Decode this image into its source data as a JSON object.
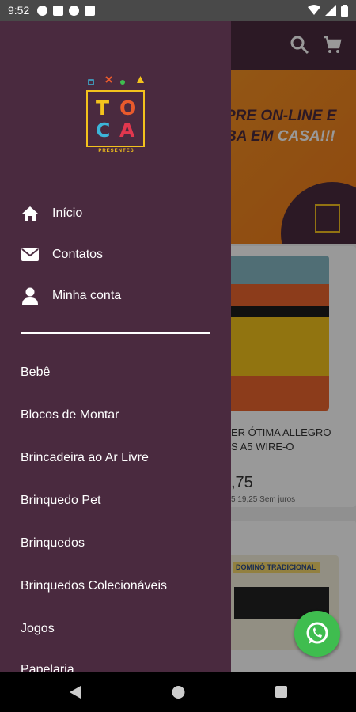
{
  "status_bar": {
    "time": "9:52"
  },
  "app": {
    "banner": {
      "line1": "PRE ON-LINE E",
      "line2_a": "BA EM ",
      "line2_b": "CASA!!!"
    },
    "product1": {
      "title_line1": "ER ÓTIMA ALLEGRO",
      "title_line2": "S A5 WIRE-O",
      "price": ",75",
      "installments": "5 19,25 Sem juros"
    },
    "product2": {
      "label": "DOMINÓ TRADICIONAL"
    }
  },
  "drawer": {
    "logo": {
      "letters": [
        "T",
        "O",
        "C",
        "A"
      ],
      "subtitle": "PRESENTES",
      "colors": [
        "#f3c21d",
        "#e95a2c",
        "#3cb5d9",
        "#e2374e"
      ]
    },
    "nav": [
      {
        "label": "Início",
        "icon": "home-icon"
      },
      {
        "label": "Contatos",
        "icon": "envelope-icon"
      },
      {
        "label": "Minha conta",
        "icon": "user-icon"
      }
    ],
    "categories": [
      "Bebê",
      "Blocos de Montar",
      "Brincadeira ao Ar Livre",
      "Brinquedo Pet",
      "Brinquedos",
      "Brinquedos Colecionáveis",
      "Jogos",
      "Papelaria"
    ]
  },
  "colors": {
    "drawer_bg": "#4a2a3f",
    "whatsapp": "#3fbd4f",
    "banner": "#f7a12a"
  }
}
